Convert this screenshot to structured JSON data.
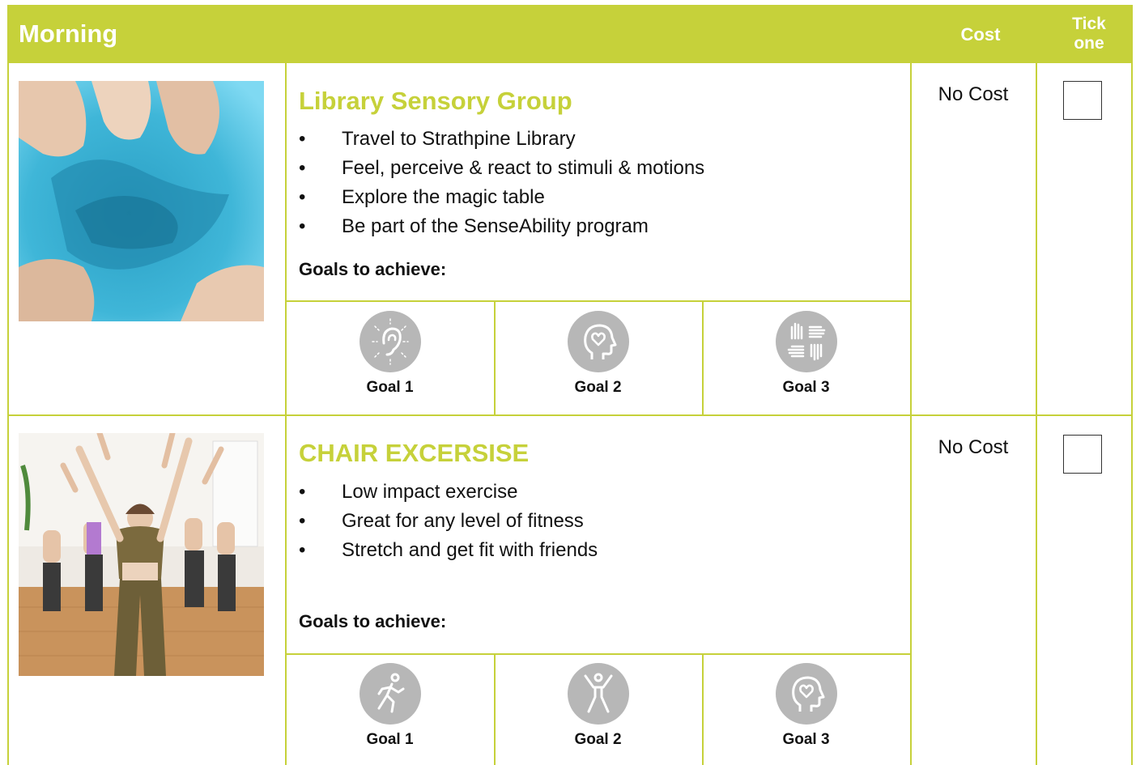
{
  "header": {
    "title": "Morning",
    "cost": "Cost",
    "tick_line1": "Tick",
    "tick_line2": "one"
  },
  "activities": [
    {
      "title": "Library Sensory Group",
      "bullets": [
        "Travel to Strathpine Library",
        "Feel, perceive & react to stimuli & motions",
        "Explore the magic table",
        "Be part of the SenseAbility program"
      ],
      "goals_label": "Goals to achieve:",
      "goals": [
        {
          "icon": "hearing-icon",
          "label": "Goal 1"
        },
        {
          "icon": "head-heart-icon",
          "label": "Goal 2"
        },
        {
          "icon": "hands-teamwork-icon",
          "label": "Goal 3"
        }
      ],
      "cost": "No Cost"
    },
    {
      "title": "CHAIR EXCERSISE",
      "bullets": [
        "Low impact exercise",
        "Great for any level of fitness",
        "Stretch and get fit with friends"
      ],
      "goals_label": "Goals to achieve:",
      "goals": [
        {
          "icon": "running-person-icon",
          "label": "Goal 1"
        },
        {
          "icon": "jumping-person-icon",
          "label": "Goal 2"
        },
        {
          "icon": "head-heart-icon",
          "label": "Goal 3"
        }
      ],
      "cost": "No Cost"
    }
  ],
  "colors": {
    "accent": "#c6d13a",
    "icon_grey": "#b7b7b7",
    "sand_blue": "#3fb6d8"
  }
}
